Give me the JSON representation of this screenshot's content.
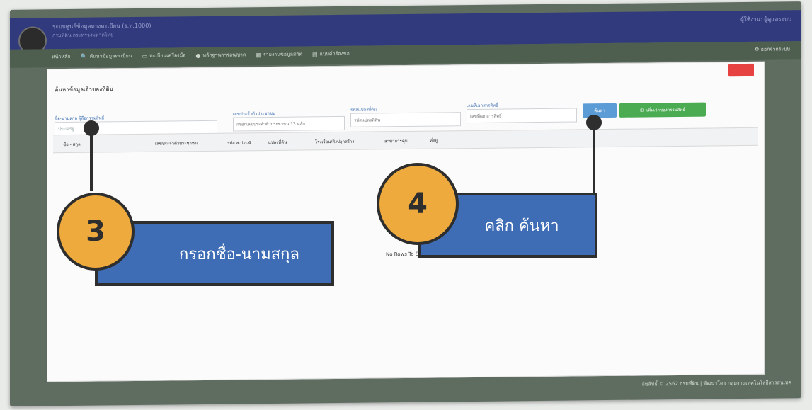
{
  "app": {
    "title": "ระบบศูนย์ข้อมูลทางทะเบียน (ร.ท.1000)",
    "subtitle": "กรมที่ดิน กระทรวงมหาดไทย",
    "user": "ผู้ใช้งาน: ผู้ดูแลระบบ"
  },
  "menu": {
    "items": [
      {
        "label": "หน้าหลัก",
        "icon": ""
      },
      {
        "label": "ค้นหาข้อมูลทะเบียน",
        "icon": "🔍"
      },
      {
        "label": "ทะเบียนเครื่องมือ",
        "icon": "▭"
      },
      {
        "label": "หลักฐานการอนุญาต",
        "icon": "●"
      },
      {
        "label": "รายงานข้อมูลสถิติ",
        "icon": "▦"
      },
      {
        "label": "แบบคำร้องขอ",
        "icon": "▤"
      }
    ],
    "settings": "ออกจากระบบ"
  },
  "panel": {
    "title": "ค้นหาข้อมูลเจ้าของที่ดิน"
  },
  "form": {
    "name_label": "ชื่อ-นามสกุล ผู้ถือกรรมสิทธิ์",
    "name_value": "ประเสริฐ",
    "id_label": "เลขประจำตัวประชาชน",
    "id_placeholder": "กรอกเลขประจำตัวประชาชน 13 หลัก",
    "parcel_label": "รหัสแปลงที่ดิน",
    "parcel_placeholder": "รหัสแปลงที่ดิน",
    "doc_label": "เลขที่เอกสารสิทธิ์",
    "doc_placeholder": "เลขที่เอกสารสิทธิ์",
    "search_button": "ค้นหา",
    "add_button": "เพิ่มเจ้าของกรรมสิทธิ์"
  },
  "table": {
    "headers": [
      "ชื่อ - สกุล",
      "เลขประจำตัวประชาชน",
      "รหัส ส.ป.ก.4",
      "แปลงที่ดิน",
      "โรงเรือน/สิ่งปลูกสร้าง",
      "สาขาการคุม",
      "ที่อยู่"
    ],
    "empty": "No Rows To Show"
  },
  "footer": "ลิขสิทธิ์ © 2562 กรมที่ดิน | พัฒนาโดย กลุ่มงานเทคโนโลยีสารสนเทศ",
  "annotations": [
    {
      "number": "3",
      "text": "กรอกชื่อ-นามสกุล"
    },
    {
      "number": "4",
      "text": "คลิก ค้นหา"
    }
  ],
  "colors": {
    "topbar": "#323a7e",
    "search_button": "#5b9bd6",
    "add_button": "#4aab52",
    "close_button": "#e74242",
    "badge": "#eeaa3d",
    "callout": "#3e6db5"
  }
}
